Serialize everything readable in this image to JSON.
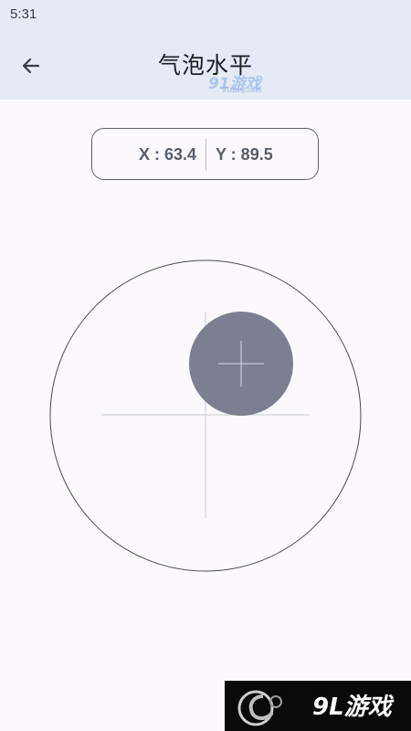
{
  "status_bar": {
    "time": "5:31"
  },
  "app_bar": {
    "back_icon": "arrow-left-icon",
    "title": "气泡水平"
  },
  "readout": {
    "x_text": "X : 63.4",
    "y_text": "Y : 89.5"
  },
  "level": {
    "bubble_color": "#7b7f91",
    "outer_ring_color": "#4a4a52",
    "crosshair_color": "#c9ccd6",
    "bubble_cross_color": "#d6d9e3"
  },
  "watermark": {
    "top_logo": "91游戏",
    "top_url": "91danji.com",
    "bottom_logo": "9L游戏"
  }
}
